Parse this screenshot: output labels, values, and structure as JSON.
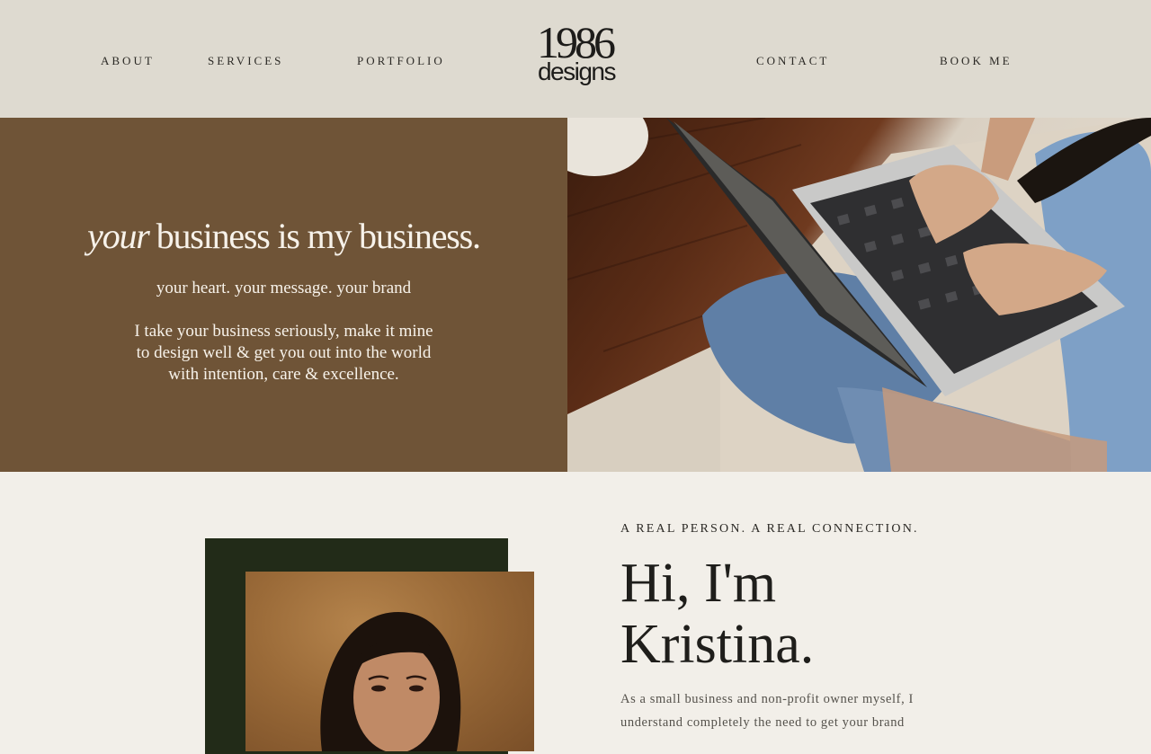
{
  "nav": {
    "left": [
      "ABOUT",
      "SERVICES",
      "PORTFOLIO"
    ],
    "right": [
      "CONTACT",
      "BOOK ME"
    ]
  },
  "logo": {
    "number": "1986",
    "word": "designs"
  },
  "hero": {
    "headline_italic": "your",
    "headline_rest": "business is my business.",
    "tagline": "your heart. your message. your brand",
    "body_lines": [
      "I take your business seriously, make it mine",
      "to design well & get you out into the world",
      "with intention, care & excellence."
    ]
  },
  "about": {
    "eyebrow": "A REAL PERSON. A REAL CONNECTION.",
    "greeting_lines": [
      "Hi, I'm",
      "Kristina."
    ],
    "bio": "As a small business and non-profit owner myself, I understand completely the need to get your brand"
  },
  "colors": {
    "header_bg": "#dedad0",
    "hero_bg": "#6f5437",
    "page_bg": "#f2efe9",
    "portrait_backdrop": "#222b18"
  }
}
